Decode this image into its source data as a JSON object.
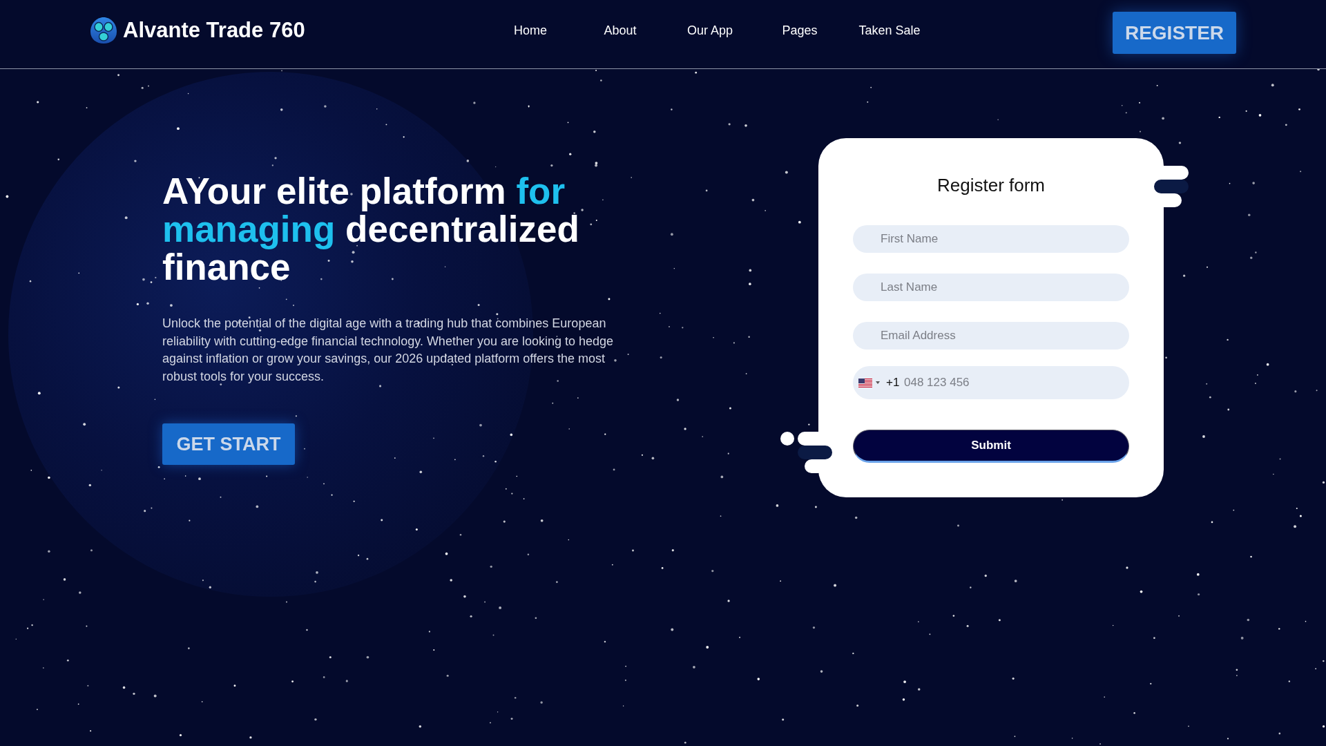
{
  "header": {
    "brand": "Alvante Trade 760",
    "nav": [
      "Home",
      "About",
      "Our App",
      "Pages",
      "Taken Sale"
    ],
    "register_button": "REGISTER"
  },
  "hero": {
    "headline": [
      {
        "text": "AYour elite platform ",
        "highlight": false
      },
      {
        "text": "for managing",
        "highlight": true
      },
      {
        "text": " decentralized finance",
        "highlight": false
      }
    ],
    "description": "Unlock the potential of the digital age with a trading hub that combines European reliability with cutting-edge financial technology. Whether you are looking to hedge against inflation or grow your savings, our 2026 updated platform offers the most robust tools for your success.",
    "cta_button": "GET START"
  },
  "register_form": {
    "title": "Register form",
    "fields": [
      {
        "placeholder": "First Name"
      },
      {
        "placeholder": "Last Name"
      },
      {
        "placeholder": "Email Address"
      }
    ],
    "phone": {
      "dial_code": "+1",
      "placeholder": "048 123 456"
    },
    "submit_button": "Submit"
  }
}
